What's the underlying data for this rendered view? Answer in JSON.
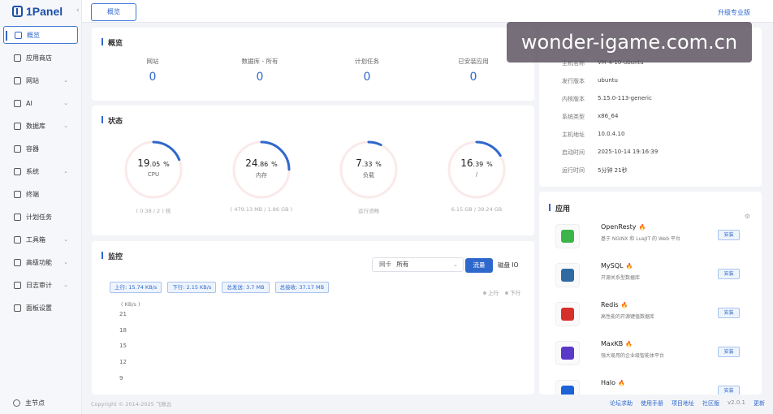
{
  "sidebar": {
    "logo": "1Panel",
    "items": [
      {
        "label": "概览",
        "active": true,
        "icon": "home-icon",
        "chevron": false
      },
      {
        "label": "应用商店",
        "active": false,
        "icon": "apps-icon",
        "chevron": false
      },
      {
        "label": "网站",
        "active": false,
        "icon": "globe-icon",
        "chevron": true
      },
      {
        "label": "AI",
        "active": false,
        "icon": "robot-icon",
        "chevron": true
      },
      {
        "label": "数据库",
        "active": false,
        "icon": "database-icon",
        "chevron": true
      },
      {
        "label": "容器",
        "active": false,
        "icon": "container-icon",
        "chevron": false
      },
      {
        "label": "系统",
        "active": false,
        "icon": "system-icon",
        "chevron": true
      },
      {
        "label": "终端",
        "active": false,
        "icon": "terminal-icon",
        "chevron": false
      },
      {
        "label": "计划任务",
        "active": false,
        "icon": "cron-icon",
        "chevron": false
      },
      {
        "label": "工具箱",
        "active": false,
        "icon": "toolbox-icon",
        "chevron": true
      },
      {
        "label": "高级功能",
        "active": false,
        "icon": "diamond-icon",
        "chevron": true
      },
      {
        "label": "日志审计",
        "active": false,
        "icon": "log-icon",
        "chevron": true
      },
      {
        "label": "面板设置",
        "active": false,
        "icon": "settings-icon",
        "chevron": false
      }
    ],
    "footer_label": "主节点"
  },
  "topbar": {
    "tab_label": "概览",
    "upgrade_label": "升级专业版"
  },
  "overview": {
    "title": "概览",
    "stats": [
      {
        "label": "网站",
        "value": "0"
      },
      {
        "label": "数据库 - 所有",
        "value": "0"
      },
      {
        "label": "计划任务",
        "value": "0"
      },
      {
        "label": "已安装应用",
        "value": "0"
      }
    ]
  },
  "status": {
    "title": "状态",
    "gauges": [
      {
        "name": "CPU",
        "int": "19",
        "dec": ".05",
        "unit": "%",
        "percent": 19.05,
        "sub": "( 0.38 / 2 ) 核"
      },
      {
        "name": "内存",
        "int": "24",
        "dec": ".86",
        "unit": "%",
        "percent": 24.86,
        "sub": "( 479.13 MB / 1.86 GB )"
      },
      {
        "name": "负载",
        "int": "7",
        "dec": ".33",
        "unit": "%",
        "percent": 7.33,
        "sub": "运行流畅"
      },
      {
        "name": "/",
        "int": "16",
        "dec": ".39",
        "unit": "%",
        "percent": 16.39,
        "sub": "6.15 GB / 39.24 GB"
      }
    ]
  },
  "monitor": {
    "title": "监控",
    "select_label": "网卡",
    "select_value": "所有",
    "btn_flow": "流量",
    "btn_disk": "磁盘 IO",
    "legend_up": "上行",
    "legend_down": "下行",
    "tags": [
      "上行: 15.74 KB/s",
      "下行: 2.15 KB/s",
      "总发送: 3.7 MB",
      "总接收: 37.17 MB"
    ],
    "unit": "( KB/s )",
    "yticks": [
      "21",
      "18",
      "15",
      "12",
      "9"
    ]
  },
  "sysinfo": {
    "rows": [
      {
        "key": "主机名称",
        "val": "VM-4-10-ubuntu"
      },
      {
        "key": "发行版本",
        "val": "ubuntu"
      },
      {
        "key": "内核版本",
        "val": "5.15.0-113-generic"
      },
      {
        "key": "系统类型",
        "val": "x86_64"
      },
      {
        "key": "主机地址",
        "val": "10.0.4.10"
      },
      {
        "key": "启动时间",
        "val": "2025-10-14 19:16:39"
      },
      {
        "key": "运行时间",
        "val": "5分钟 21秒"
      }
    ]
  },
  "apps": {
    "title": "应用",
    "install_label": "安装",
    "items": [
      {
        "name": "OpenResty",
        "desc": "基于 NGINX 和 LuaJIT 的 Web 平台",
        "color": "#3bb54a"
      },
      {
        "name": "MySQL",
        "desc": "开源关系型数据库",
        "color": "#2f6aa0"
      },
      {
        "name": "Redis",
        "desc": "高性能的开源键值数据库",
        "color": "#d6302a"
      },
      {
        "name": "MaxKB",
        "desc": "强大易用的企业级智能体平台",
        "color": "#5a38c8"
      },
      {
        "name": "Halo",
        "desc": "",
        "color": "#1d62d6"
      }
    ]
  },
  "footer": {
    "copyright": "Copyright © 2014-2025 飞致云",
    "links": [
      "论坛求助",
      "使用手册",
      "项目地址"
    ],
    "edition": "社区版",
    "version": "v2.0.1",
    "update": "更新"
  },
  "watermark": "wonder-igame.com.cn",
  "colors": {
    "accent": "#2f68cc",
    "gauge_track": "#fbeaea"
  }
}
